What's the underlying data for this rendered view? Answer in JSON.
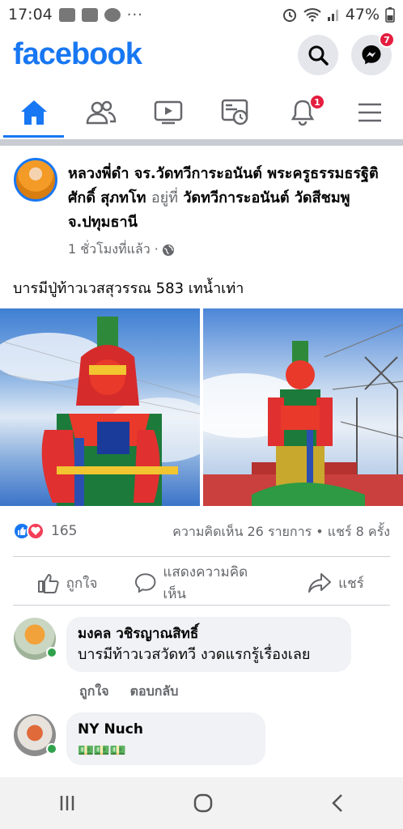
{
  "status_bar": {
    "time": "17:04",
    "battery": "47%",
    "more": "···"
  },
  "header": {
    "logo": "facebook",
    "messenger_badge": "7"
  },
  "nav": {
    "notifications_badge": "1"
  },
  "post": {
    "author": "หลวงพี่ดำ จร.วัดทวีการะอนันต์ พระครูธรรมธรฐิติศักดิ์ สุภทโท",
    "at_text": "อยู่ที่",
    "place": "วัดทวีการะอนันต์ วัดสีชมพู จ.ปทุมธานี",
    "time": "1 ชั่วโมงที่แล้ว ·",
    "text": "บารมีปู่ท้าวเวสสุวรรณ 583 เทน้ำเท่า",
    "reaction_count": "165",
    "comments_shares": "ความคิดเห็น 26 รายการ • แชร์ 8 ครั้ง"
  },
  "actions": {
    "like": "ถูกใจ",
    "comment": "แสดงความคิดเห็น",
    "share": "แชร์"
  },
  "comments": [
    {
      "name": "มงคล วชิรญาณสิทธิ์",
      "text": "บารมีท้าวเวสวัดทวี งวดแรกรู้เรื่องเลย",
      "like": "ถูกใจ",
      "reply": "ตอบกลับ"
    },
    {
      "name": "NY Nuch",
      "text": "💵💵💵"
    }
  ],
  "colors": {
    "brand": "#1877f2",
    "badge": "#e41e3f",
    "online": "#31a24c"
  }
}
